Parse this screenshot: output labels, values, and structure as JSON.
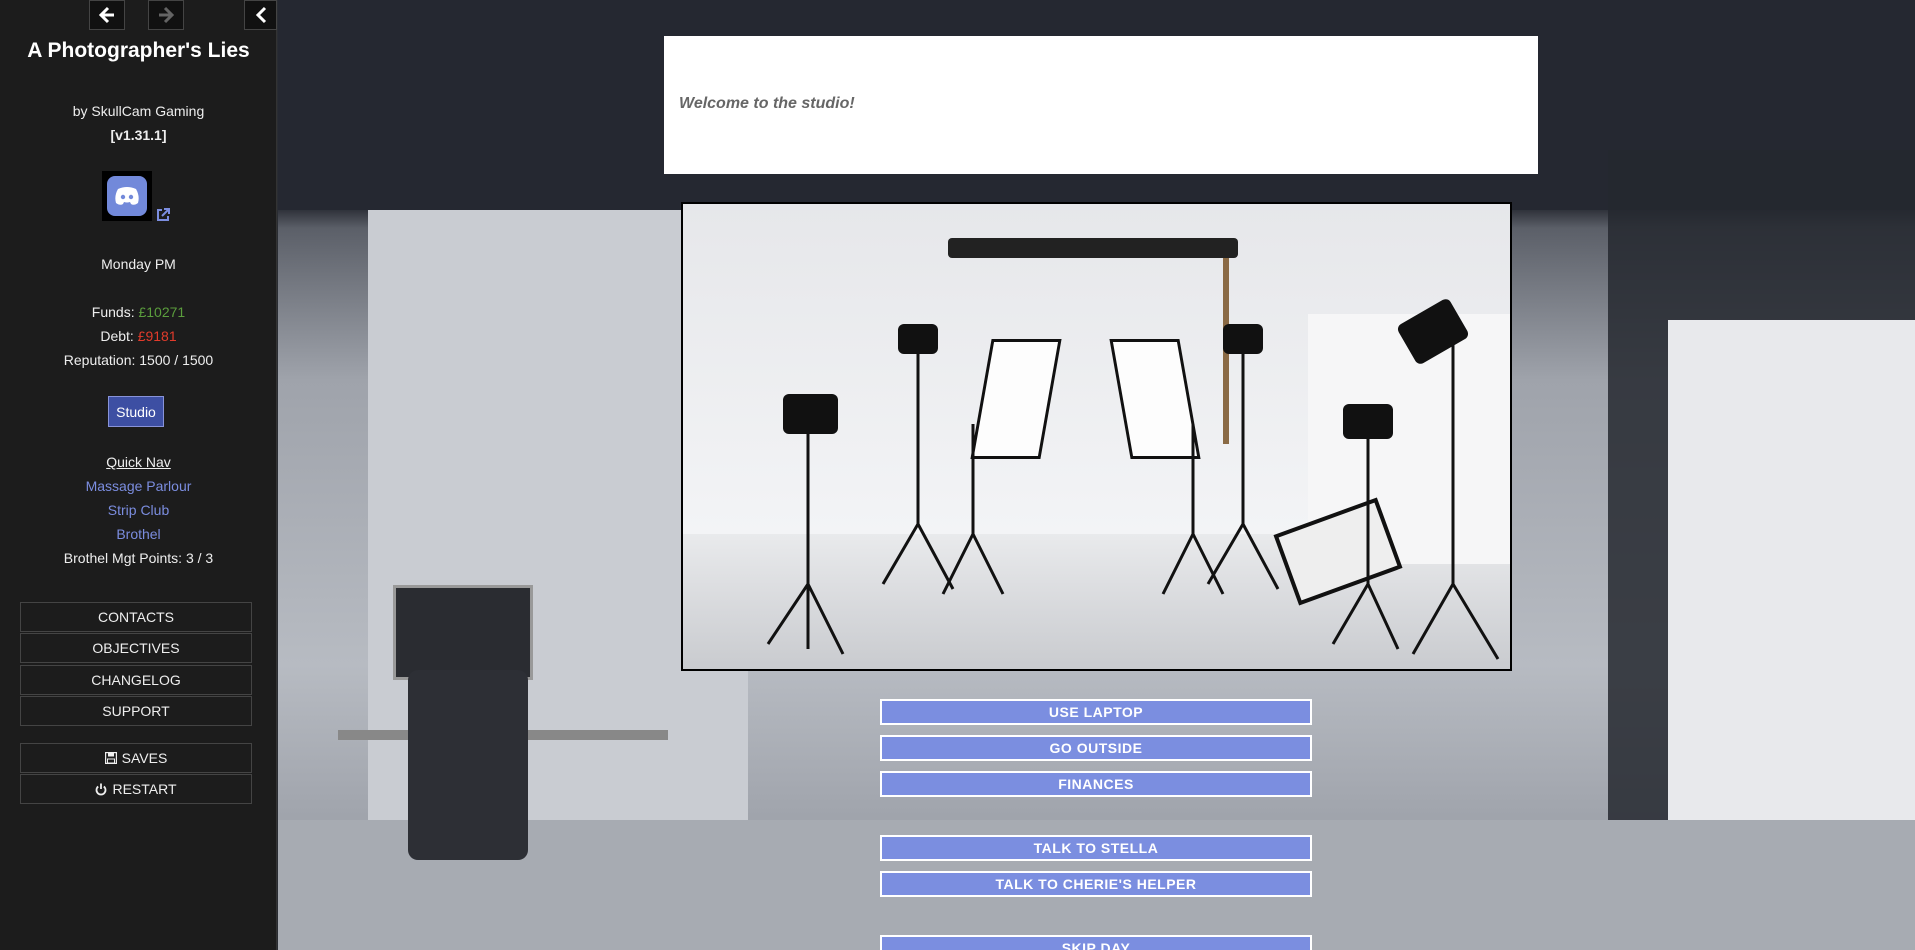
{
  "sidebar": {
    "title": "A Photographer's Lies",
    "author": "by SkullCam Gaming",
    "version": "[v1.31.1]",
    "day_time": "Monday PM",
    "funds_label": "Funds: ",
    "funds_value": "£10271",
    "debt_label": "Debt: ",
    "debt_value": "£9181",
    "reputation": "Reputation: 1500 / 1500",
    "location_button": "Studio",
    "quick_nav": "Quick Nav",
    "nav_links": [
      "Massage Parlour",
      "Strip Club",
      "Brothel"
    ],
    "brothel_points": "Brothel Mgt Points: 3 / 3",
    "menu": [
      "CONTACTS",
      "OBJECTIVES",
      "CHANGELOG",
      "SUPPORT"
    ],
    "saves": "SAVES",
    "restart": "RESTART"
  },
  "main": {
    "narration": "Welcome to the studio!",
    "actions": [
      "USE LAPTOP",
      "GO OUTSIDE",
      "FINANCES",
      "TALK TO STELLA",
      "TALK TO CHERIE'S HELPER",
      "SKIP DAY"
    ]
  },
  "colors": {
    "funds": "#5b9d3d",
    "debt": "#e23b2b",
    "link": "#7b8ddf",
    "action_button": "#7b8ee0",
    "studio_button": "#3d4fa3"
  },
  "icons": [
    "back-arrow-icon",
    "forward-arrow-icon",
    "collapse-chevron-icon",
    "discord-icon",
    "external-link-icon",
    "save-icon",
    "power-icon"
  ]
}
